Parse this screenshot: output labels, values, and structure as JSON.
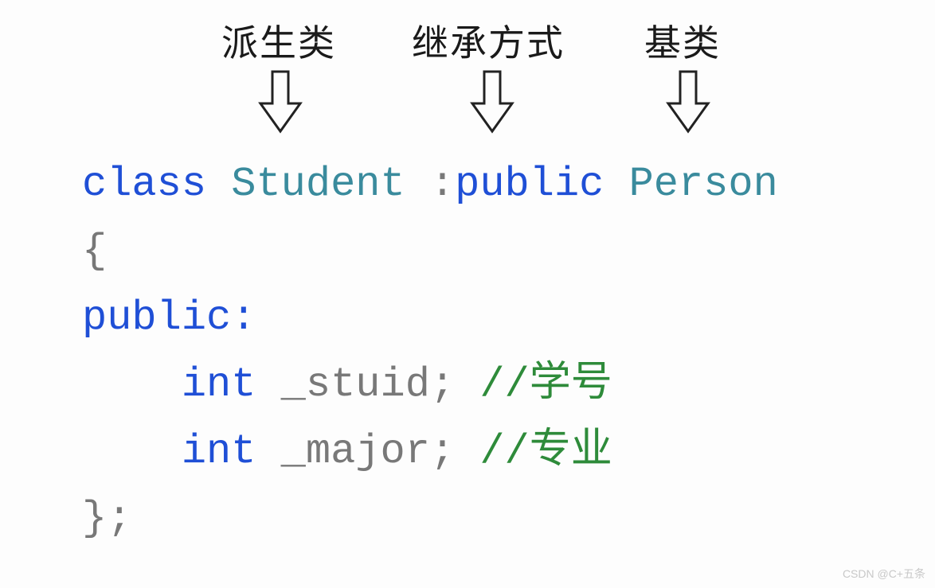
{
  "annotations": {
    "derived": "派生类",
    "mode": "继承方式",
    "base": "基类"
  },
  "code": {
    "class_kw": "class",
    "student": "Student",
    "colon": ":",
    "public_inh": "public",
    "person": "Person",
    "lbrace": "{",
    "public_lbl": "public:",
    "int1": "int",
    "stuid": "_stuid;",
    "c_stuid": "//学号",
    "int2": "int",
    "major": "_major;",
    "c_major": "//专业",
    "rbrace": "};"
  },
  "watermark": "CSDN @C+五条"
}
